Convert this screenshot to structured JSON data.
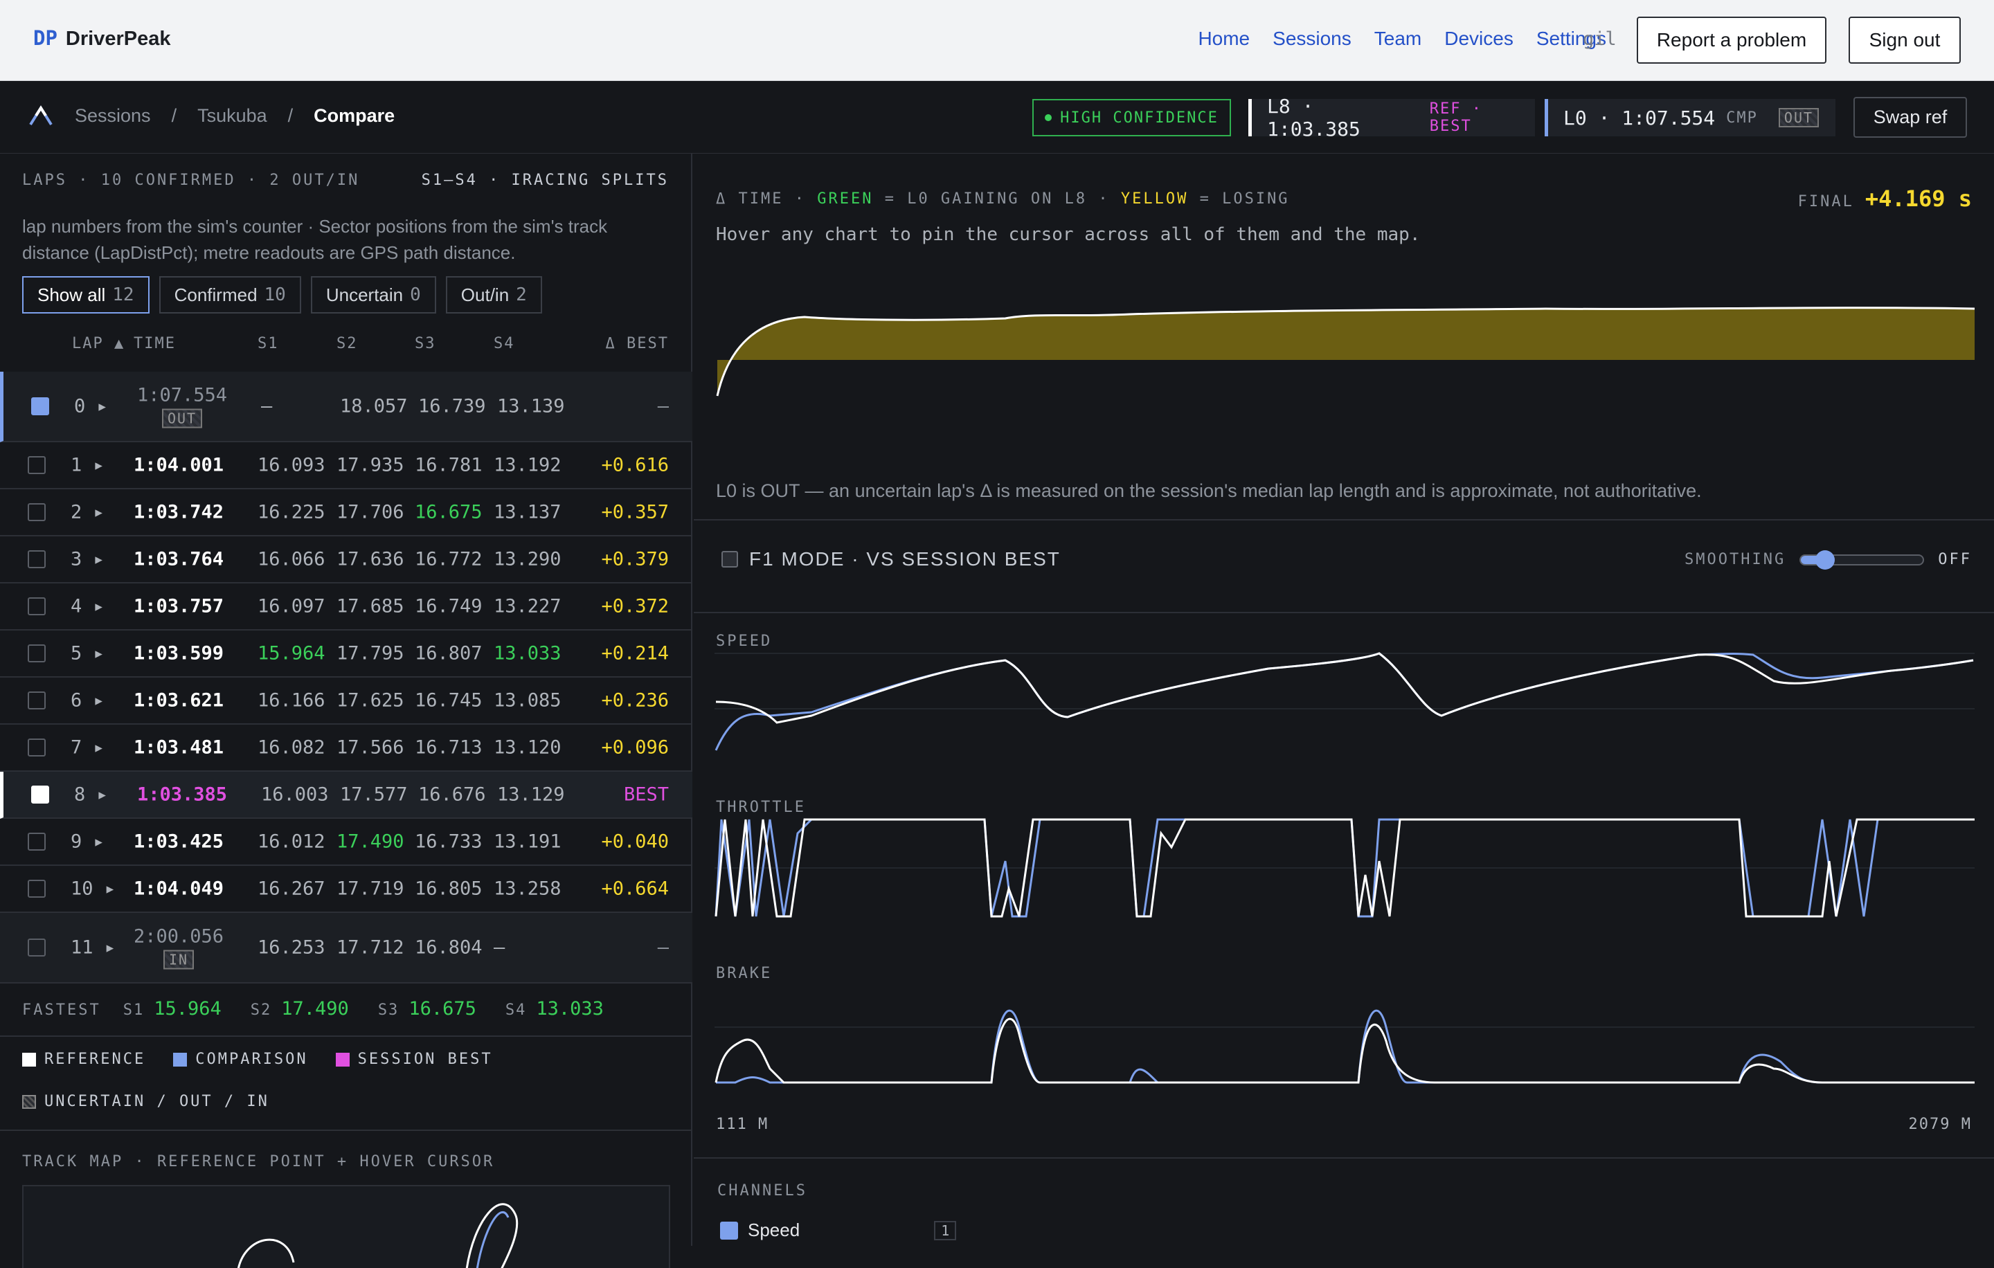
{
  "app": {
    "logo": "DP",
    "name": "DriverPeak"
  },
  "nav": {
    "links": [
      "Home",
      "Sessions",
      "Team",
      "Devices",
      "Settings"
    ],
    "user": "gil",
    "report": "Report a problem",
    "signout": "Sign out"
  },
  "breadcrumb": {
    "items": [
      "Sessions",
      "Tsukuba",
      "Compare"
    ],
    "sep": "/"
  },
  "confidence": "HIGH CONFIDENCE",
  "ref": {
    "lap": "L8 · 1:03.385",
    "tag": "REF · BEST"
  },
  "cmp": {
    "lap": "L0 · 1:07.554",
    "tag": "CMP",
    "badge": "OUT"
  },
  "swap": "Swap ref",
  "laps": {
    "header_left": "LAPS · 10 CONFIRMED · 2 OUT/IN",
    "header_right": "S1–S4 · IRACING SPLITS",
    "note": "lap numbers from the sim's counter · Sector positions from the sim's track distance (LapDistPct); metre readouts are GPS path distance.",
    "filters": [
      {
        "label": "Show all",
        "count": "12"
      },
      {
        "label": "Confirmed",
        "count": "10"
      },
      {
        "label": "Uncertain",
        "count": "0"
      },
      {
        "label": "Out/in",
        "count": "2"
      }
    ],
    "columns": [
      "LAP ▲",
      "TIME",
      "S1",
      "S2",
      "S3",
      "S4",
      "Δ BEST"
    ],
    "rows": [
      {
        "lap": "0 ▸",
        "time": "1:07.554",
        "badge": "OUT",
        "s1": "—",
        "s2": "18.057",
        "s3": "16.739",
        "s4": "13.139",
        "delta": "—"
      },
      {
        "lap": "1 ▸",
        "time": "1:04.001",
        "s1": "16.093",
        "s2": "17.935",
        "s3": "16.781",
        "s4": "13.192",
        "delta": "+0.616"
      },
      {
        "lap": "2 ▸",
        "time": "1:03.742",
        "s1": "16.225",
        "s2": "17.706",
        "s3": "16.675",
        "s4": "13.137",
        "delta": "+0.357"
      },
      {
        "lap": "3 ▸",
        "time": "1:03.764",
        "s1": "16.066",
        "s2": "17.636",
        "s3": "16.772",
        "s4": "13.290",
        "delta": "+0.379"
      },
      {
        "lap": "4 ▸",
        "time": "1:03.757",
        "s1": "16.097",
        "s2": "17.685",
        "s3": "16.749",
        "s4": "13.227",
        "delta": "+0.372"
      },
      {
        "lap": "5 ▸",
        "time": "1:03.599",
        "s1": "15.964",
        "s2": "17.795",
        "s3": "16.807",
        "s4": "13.033",
        "delta": "+0.214"
      },
      {
        "lap": "6 ▸",
        "time": "1:03.621",
        "s1": "16.166",
        "s2": "17.625",
        "s3": "16.745",
        "s4": "13.085",
        "delta": "+0.236"
      },
      {
        "lap": "7 ▸",
        "time": "1:03.481",
        "s1": "16.082",
        "s2": "17.566",
        "s3": "16.713",
        "s4": "13.120",
        "delta": "+0.096"
      },
      {
        "lap": "8 ▸",
        "time": "1:03.385",
        "s1": "16.003",
        "s2": "17.577",
        "s3": "16.676",
        "s4": "13.129",
        "delta": "BEST"
      },
      {
        "lap": "9 ▸",
        "time": "1:03.425",
        "s1": "16.012",
        "s2": "17.490",
        "s3": "16.733",
        "s4": "13.191",
        "delta": "+0.040"
      },
      {
        "lap": "10 ▸",
        "time": "1:04.049",
        "s1": "16.267",
        "s2": "17.719",
        "s3": "16.805",
        "s4": "13.258",
        "delta": "+0.664"
      },
      {
        "lap": "11 ▸",
        "time": "2:00.056",
        "badge": "IN",
        "s1": "16.253",
        "s2": "17.712",
        "s3": "16.804",
        "s4": "—",
        "delta": "—"
      }
    ],
    "fastest": {
      "label": "FASTEST",
      "s1k": "S1",
      "s1": "15.964",
      "s2k": "S2",
      "s2": "17.490",
      "s3k": "S3",
      "s3": "16.675",
      "s4k": "S4",
      "s4": "13.033"
    }
  },
  "legend": {
    "reference": "REFERENCE",
    "comparison": "COMPARISON",
    "session_best": "SESSION BEST",
    "uncertain": "UNCERTAIN / OUT / IN"
  },
  "trackmap": {
    "title": "TRACK MAP · REFERENCE POINT + HOVER CURSOR"
  },
  "delta": {
    "title_prefix": "Δ TIME ·",
    "green_word": "GREEN",
    "mid": "= L0 GAINING ON L8 ·",
    "yellow_word": "YELLOW",
    "suffix": "= LOSING",
    "final_label": "FINAL",
    "final_value": "+4.169 s",
    "hover_note": "Hover any chart to pin the cursor across all of them and the map.",
    "out_note": "L0 is OUT — an uncertain lap's Δ is measured on the session's median lap length and is approximate, not authoritative."
  },
  "f1": {
    "label": "F1 MODE · VS SESSION BEST",
    "smoothing": "SMOOTHING",
    "smoothing_value": "OFF",
    "smoothing_level": 0.2
  },
  "charts": {
    "speed": "SPEED",
    "throttle": "THROTTLE",
    "brake": "BRAKE",
    "x_start": "111 M",
    "x_end": "2079 M"
  },
  "channels": {
    "title": "CHANNELS",
    "first": "Speed",
    "first_count": "1"
  },
  "colors": {
    "reference": "#ffffff",
    "comparison": "#7ea1ec",
    "best": "#e050e0",
    "gain": "#3bd05a",
    "loss": "#f5d82f",
    "delta_fill": "#6b5e12"
  }
}
